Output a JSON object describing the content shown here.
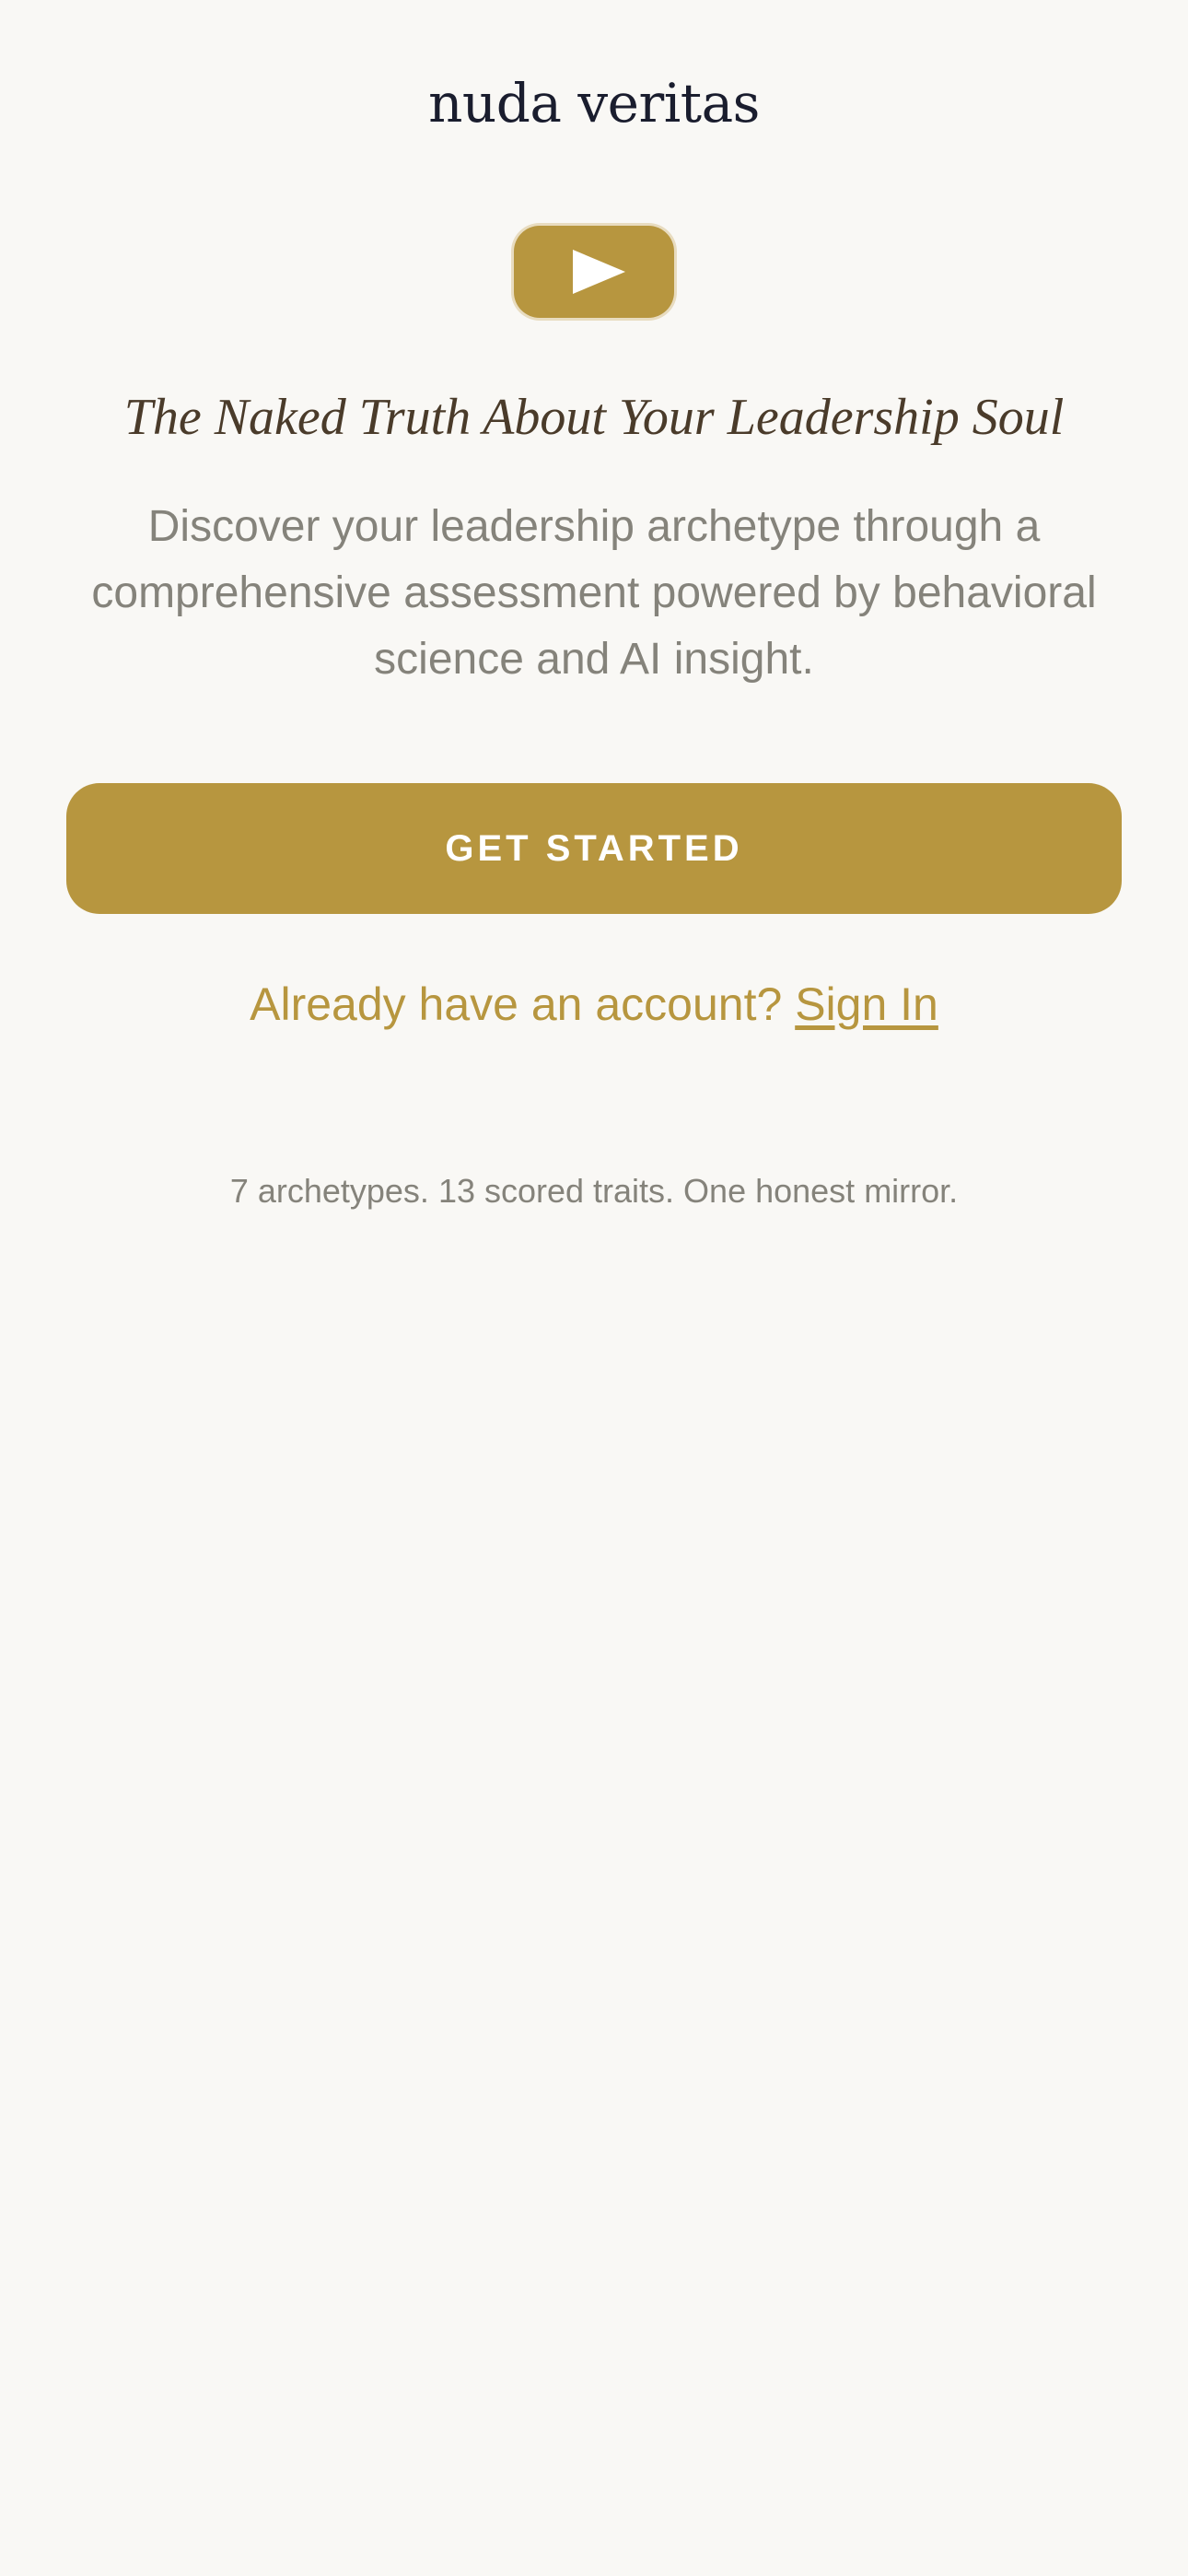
{
  "app": {
    "brand": "nuda veritas"
  },
  "hero": {
    "icon": "play-icon",
    "tagline": "The Naked Truth About Your Leadership Soul",
    "description": "Discover your leadership archetype through a comprehensive assessment powered by behavioral science and AI insight."
  },
  "actions": {
    "get_started_label": "GET STARTED",
    "account_prompt": "Already have an account?",
    "sign_in_label": "Sign In"
  },
  "footer": {
    "summary": "7 archetypes. 13 scored traits. One honest mirror."
  },
  "colors": {
    "background": "#f9f8f5",
    "accent": "#b7963f",
    "brand_text": "#1a1d2e",
    "tagline_text": "#4a3b2a",
    "muted_text": "#85837b"
  }
}
